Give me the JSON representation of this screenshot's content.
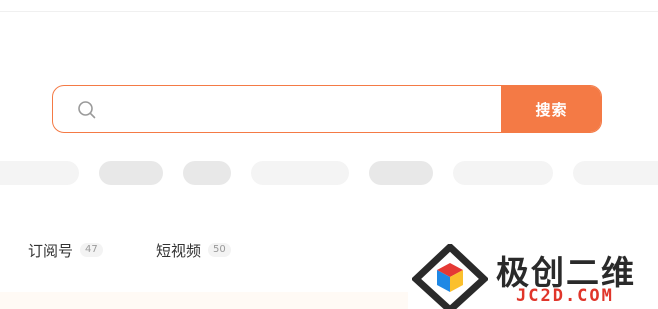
{
  "search": {
    "input_value": "",
    "placeholder": "",
    "button_label": "搜索"
  },
  "tabs": [
    {
      "label": "订阅号",
      "count": "47"
    },
    {
      "label": "短视频",
      "count": "50"
    }
  ],
  "watermark": {
    "title": "极创二维",
    "subtitle": "JC2D.COM"
  },
  "colors": {
    "accent": "#f47a45",
    "placeholder_light": "#f4f4f4",
    "placeholder_dark": "#e8e8e8",
    "watermark_red": "#e0352a"
  },
  "icons": {
    "search": "search-icon",
    "logo": "cube-diamond-logo"
  }
}
